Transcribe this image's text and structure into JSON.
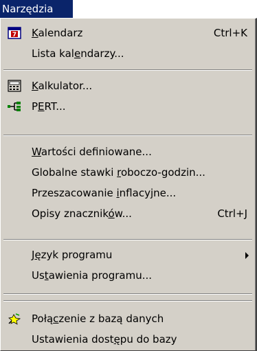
{
  "menu_title": "Narzędzia",
  "items": {
    "kalendarz": {
      "pre": "",
      "key": "K",
      "post": "alendarz",
      "shortcut": "Ctrl+K",
      "icon": "calendar-icon"
    },
    "lista": {
      "pre": "Lista kal",
      "key": "e",
      "post": "ndarzy...",
      "icon": ""
    },
    "kalkulator": {
      "pre": "",
      "key": "K",
      "post": "alkulator...",
      "icon": "calculator-icon"
    },
    "pert": {
      "pre": "P",
      "key": "E",
      "post": "RT...",
      "icon": "pert-icon"
    },
    "wartosci": {
      "pre": "",
      "key": "W",
      "post": "artości definiowane...",
      "icon": ""
    },
    "globalne": {
      "pre": "Globalne stawki ",
      "key": "r",
      "post": "oboczo-godzin...",
      "icon": ""
    },
    "przeszacowanie": {
      "pre": "Przeszacowanie ",
      "key": "i",
      "post": "nflacyjne...",
      "icon": ""
    },
    "opisy": {
      "pre": "Opisy znacznik",
      "key": "ó",
      "post": "w...",
      "shortcut": "Ctrl+J",
      "icon": ""
    },
    "jezyk": {
      "pre": "J",
      "key": "ę",
      "post": "zyk programu",
      "icon": "",
      "submenu": true
    },
    "ustawienia": {
      "pre": "Us",
      "key": "t",
      "post": "awienia programu...",
      "icon": ""
    },
    "polaczenie": {
      "pre": "Połą",
      "key": "c",
      "post": "zenie z bazą danych",
      "icon": "database-connect-icon"
    },
    "dostep": {
      "pre": "Ustawienia dost",
      "key": "ę",
      "post": "pu do bazy",
      "icon": ""
    }
  },
  "colors": {
    "highlight": "#0a246a",
    "menu_bg": "#d4d0c8"
  }
}
